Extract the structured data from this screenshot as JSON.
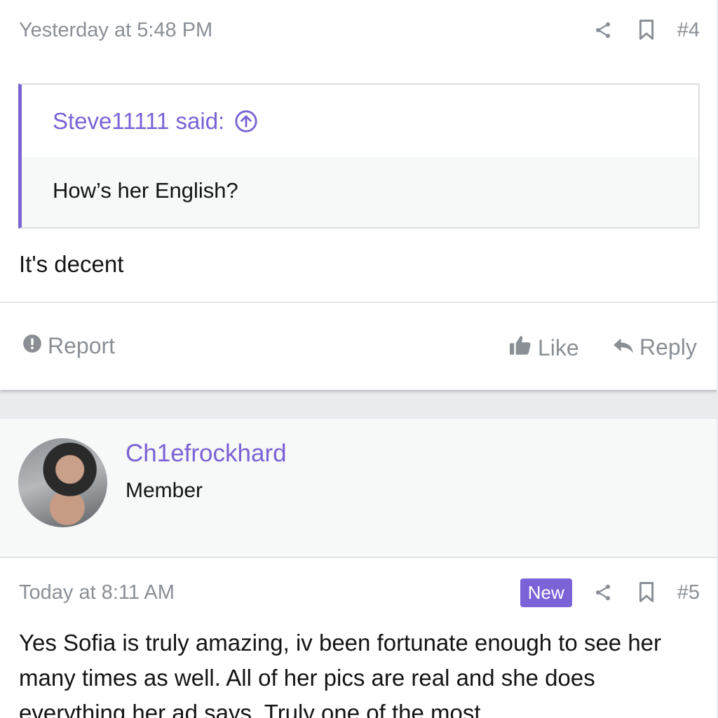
{
  "post4": {
    "time": "Yesterday at 5:48 PM",
    "number": "#4",
    "quote_author": "Steve11111 said:",
    "quote_text": "How’s her English?",
    "text": "It's decent",
    "report_label": "Report",
    "like_label": "Like",
    "reply_label": "Reply"
  },
  "user": {
    "name": "Ch1efrockhard",
    "role": "Member"
  },
  "post5": {
    "time": "Today at 8:11 AM",
    "badge": "New",
    "number": "#5",
    "text": "Yes Sofia is truly amazing, iv been fortunate enough to see her many times as well. All of her pics are real and she does everything her ad says. Truly one of the most"
  },
  "icons": {
    "share": "share-icon",
    "bookmark": "bookmark-icon",
    "quote_jump": "arrow-up-circle-icon",
    "report": "alert-circle-icon",
    "like": "thumbs-up-icon",
    "reply": "reply-arrow-icon"
  },
  "colors": {
    "accent": "#7b62d6",
    "muted": "#8a8f96",
    "text": "#141414",
    "band": "#f7f8f8"
  }
}
